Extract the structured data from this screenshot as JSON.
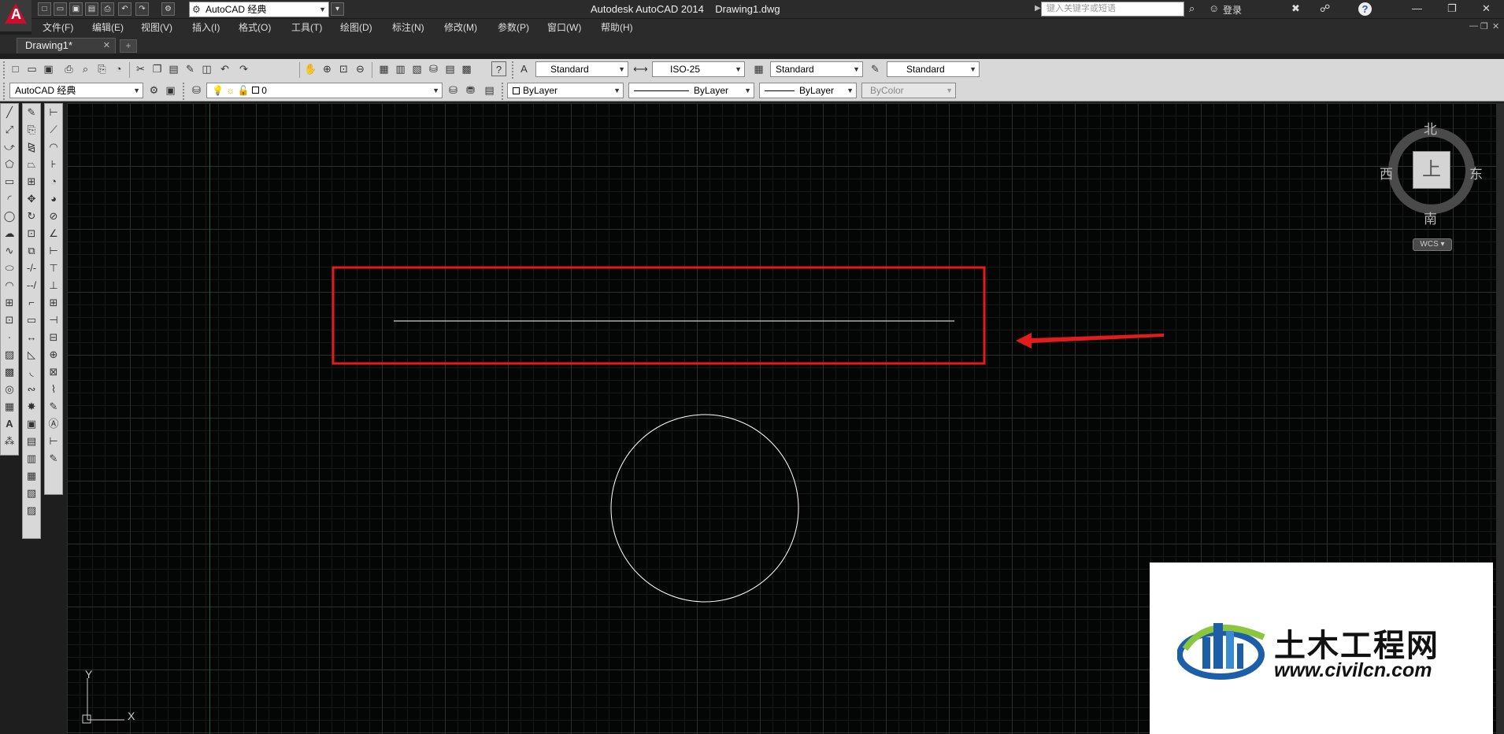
{
  "title_bar": {
    "title": "Autodesk AutoCAD 2014",
    "filename": "Drawing1.dwg",
    "workspace": "AutoCAD 经典",
    "search_placeholder": "键入关键字或短语",
    "signin_label": "登录",
    "help_icon": "question-icon"
  },
  "menu": [
    "文件(F)",
    "编辑(E)",
    "视图(V)",
    "插入(I)",
    "格式(O)",
    "工具(T)",
    "绘图(D)",
    "标注(N)",
    "修改(M)",
    "参数(P)",
    "窗口(W)",
    "帮助(H)"
  ],
  "tabs": {
    "active": "Drawing1*"
  },
  "styles_toolbar": {
    "text_style": "Standard",
    "dim_style": "ISO-25",
    "table_style": "Standard",
    "mleader_style": "Standard"
  },
  "layers_toolbar": {
    "workspace": "AutoCAD 经典",
    "layer": "0",
    "color": "ByLayer",
    "linetype": "ByLayer",
    "lineweight": "ByLayer",
    "plotstyle": "ByColor"
  },
  "viewcube": {
    "north": "北",
    "south": "南",
    "east": "东",
    "west": "西",
    "face": "上",
    "wcs_label": "WCS"
  },
  "ucs": {
    "x_label": "X",
    "y_label": "Y"
  },
  "drawing": {
    "objects": [
      "line",
      "circle"
    ],
    "highlight_color": "#e31b1b",
    "line_color": "#ffffff"
  },
  "watermark": {
    "name": "土木工程网",
    "url": "www.civilcn.com"
  }
}
